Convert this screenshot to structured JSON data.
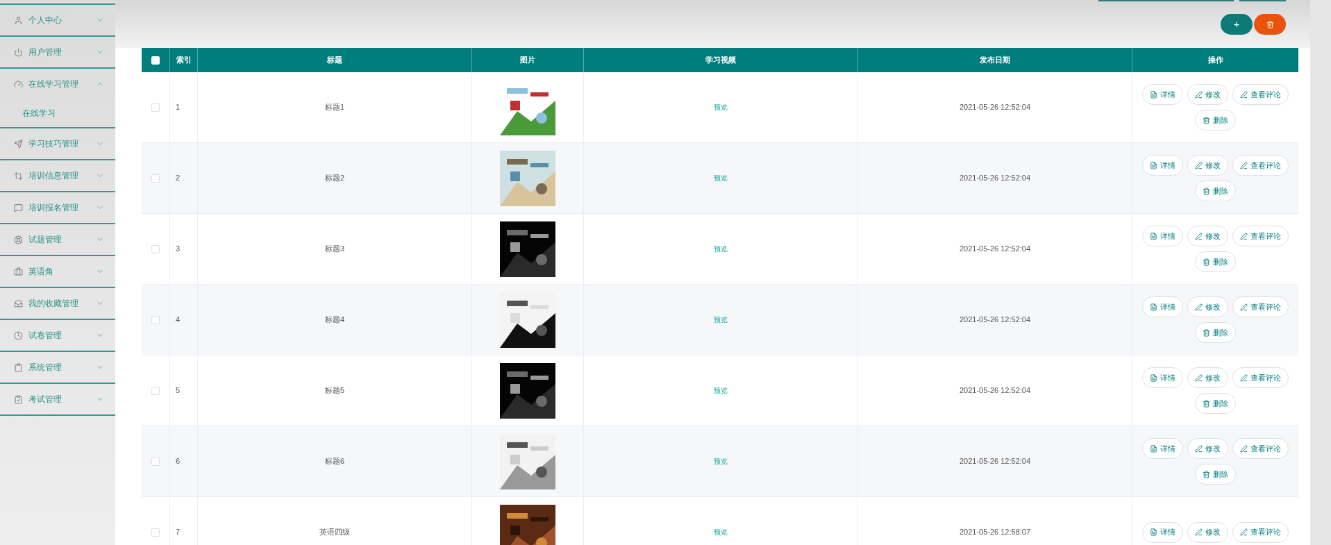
{
  "sidebar": {
    "items": [
      {
        "label": "个人中心",
        "expanded": false
      },
      {
        "label": "用户管理",
        "expanded": false
      },
      {
        "label": "在线学习管理",
        "expanded": true,
        "children": [
          {
            "label": "在线学习"
          }
        ]
      },
      {
        "label": "学习技巧管理",
        "expanded": false
      },
      {
        "label": "培训信息管理",
        "expanded": false
      },
      {
        "label": "培训报名管理",
        "expanded": false
      },
      {
        "label": "试题管理",
        "expanded": false
      },
      {
        "label": "英语角",
        "expanded": false
      },
      {
        "label": "我的收藏管理",
        "expanded": false
      },
      {
        "label": "试卷管理",
        "expanded": false
      },
      {
        "label": "系统管理",
        "expanded": false
      },
      {
        "label": "考试管理",
        "expanded": false
      }
    ]
  },
  "toolbar": {
    "buttons": [
      {
        "kind": "add",
        "label": "+"
      },
      {
        "kind": "delete"
      }
    ]
  },
  "table": {
    "columns": [
      "索引",
      "标题",
      "图片",
      "学习视频",
      "发布日期",
      "操作"
    ],
    "all_checked": false,
    "rows": [
      {
        "index": "1",
        "title": "标题1",
        "video": "预览",
        "date": "2021-05-26 12:52:04",
        "checked": false,
        "actions": [
          {
            "kind": "detail",
            "label": "详情"
          },
          {
            "kind": "edit",
            "label": "修改"
          },
          {
            "kind": "edit",
            "label": "查看评论"
          },
          {
            "kind": "delete",
            "label": "删除"
          }
        ]
      },
      {
        "index": "2",
        "title": "标题2",
        "video": "预览",
        "date": "2021-05-26 12:52:04",
        "checked": false,
        "actions": [
          {
            "kind": "detail",
            "label": "详情"
          },
          {
            "kind": "edit",
            "label": "修改"
          },
          {
            "kind": "edit",
            "label": "查看评论"
          },
          {
            "kind": "delete",
            "label": "删除"
          }
        ]
      },
      {
        "index": "3",
        "title": "标题3",
        "video": "预览",
        "date": "2021-05-26 12:52:04",
        "checked": false,
        "actions": [
          {
            "kind": "detail",
            "label": "详情"
          },
          {
            "kind": "edit",
            "label": "修改"
          },
          {
            "kind": "edit",
            "label": "查看评论"
          },
          {
            "kind": "delete",
            "label": "删除"
          }
        ]
      },
      {
        "index": "4",
        "title": "标题4",
        "video": "预览",
        "date": "2021-05-26 12:52:04",
        "checked": false,
        "actions": [
          {
            "kind": "detail",
            "label": "详情"
          },
          {
            "kind": "edit",
            "label": "修改"
          },
          {
            "kind": "edit",
            "label": "查看评论"
          },
          {
            "kind": "delete",
            "label": "删除"
          }
        ]
      },
      {
        "index": "5",
        "title": "标题5",
        "video": "预览",
        "date": "2021-05-26 12:52:04",
        "checked": false,
        "actions": [
          {
            "kind": "detail",
            "label": "详情"
          },
          {
            "kind": "edit",
            "label": "修改"
          },
          {
            "kind": "edit",
            "label": "查看评论"
          },
          {
            "kind": "delete",
            "label": "删除"
          }
        ]
      },
      {
        "index": "6",
        "title": "标题6",
        "video": "预览",
        "date": "2021-05-26 12:52:04",
        "checked": false,
        "actions": [
          {
            "kind": "detail",
            "label": "详情"
          },
          {
            "kind": "edit",
            "label": "修改"
          },
          {
            "kind": "edit",
            "label": "查看评论"
          },
          {
            "kind": "delete",
            "label": "删除"
          }
        ]
      },
      {
        "index": "7",
        "title": "英语四级",
        "video": "预览",
        "date": "2021-05-26 12:58:07",
        "checked": false,
        "actions": [
          {
            "kind": "detail",
            "label": "详情"
          },
          {
            "kind": "edit",
            "label": "修改"
          },
          {
            "kind": "edit",
            "label": "查看评论"
          }
        ]
      }
    ]
  }
}
